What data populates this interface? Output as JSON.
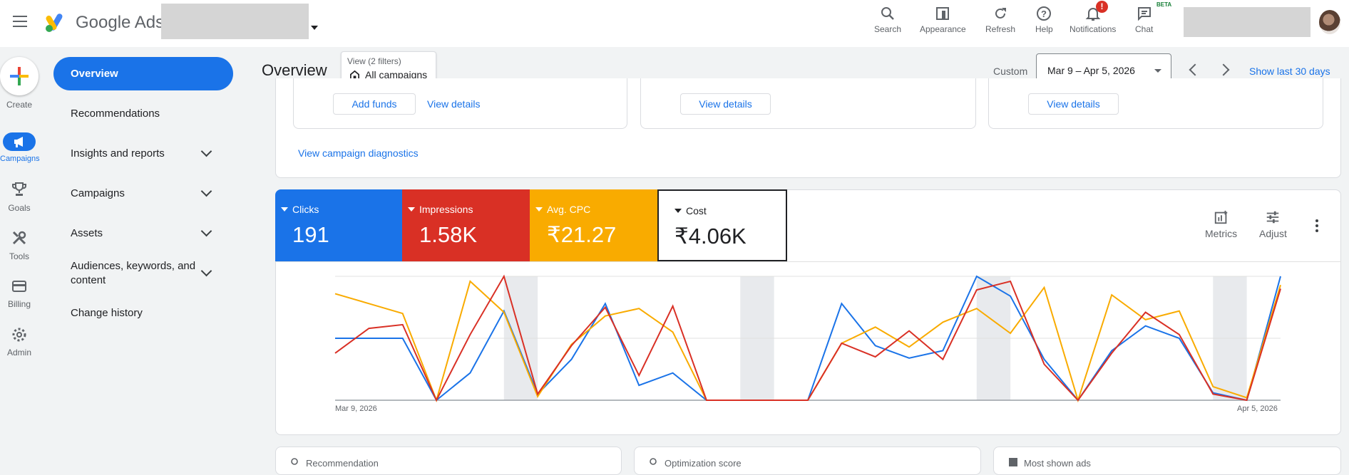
{
  "header": {
    "brand": "Google Ads",
    "tools": [
      {
        "label": "Search",
        "icon": "search-icon"
      },
      {
        "label": "Appearance",
        "icon": "appearance-icon"
      },
      {
        "label": "Refresh",
        "icon": "refresh-icon"
      },
      {
        "label": "Help",
        "icon": "help-icon"
      },
      {
        "label": "Notifications",
        "icon": "bell-icon"
      },
      {
        "label": "Chat",
        "icon": "chat-icon"
      }
    ],
    "notification_badge": "!",
    "chat_badge": "BETA"
  },
  "rail": [
    {
      "label": "Create",
      "icon": "plus-icon"
    },
    {
      "label": "Campaigns",
      "icon": "megaphone-icon"
    },
    {
      "label": "Goals",
      "icon": "trophy-icon"
    },
    {
      "label": "Tools",
      "icon": "wrench-icon"
    },
    {
      "label": "Billing",
      "icon": "card-icon"
    },
    {
      "label": "Admin",
      "icon": "gear-icon"
    }
  ],
  "sidenav": [
    {
      "label": "Overview",
      "active": true
    },
    {
      "label": "Recommendations"
    },
    {
      "label": "Insights and reports",
      "expandable": true
    },
    {
      "label": "Campaigns",
      "expandable": true
    },
    {
      "label": "Assets",
      "expandable": true
    },
    {
      "label": "Audiences, keywords, and content",
      "expandable": true
    },
    {
      "label": "Change history"
    }
  ],
  "page": {
    "title": "Overview",
    "filter_small": "View (2 filters)",
    "filter_main": "All campaigns",
    "date_label": "Custom",
    "date_range": "Mar 9 – Apr 5, 2026",
    "show_last": "Show last 30 days"
  },
  "top_cards": {
    "add_funds": "Add funds",
    "view_details": "View details",
    "diagnostics": "View campaign diagnostics"
  },
  "metrics": [
    {
      "label": "Clicks",
      "value": "191",
      "color": "#1a73e8"
    },
    {
      "label": "Impressions",
      "value": "1.58K",
      "color": "#d93025"
    },
    {
      "label": "Avg. CPC",
      "value": "₹21.27",
      "color": "#f9ab00"
    },
    {
      "label": "Cost",
      "value": "₹4.06K",
      "color": "#ffffff"
    }
  ],
  "chart_tools": {
    "metrics": "Metrics",
    "adjust": "Adjust"
  },
  "chart_data": {
    "type": "line",
    "x_start": "Mar 9, 2026",
    "x_end": "Apr 5, 2026",
    "weekend_shading": [
      [
        5,
        6
      ],
      [
        12,
        13
      ],
      [
        19,
        20
      ],
      [
        26,
        27
      ]
    ],
    "ylim": [
      0,
      1
    ],
    "series": [
      {
        "color": "#1a73e8",
        "values": [
          0.5,
          0.5,
          0.5,
          0.0,
          0.22,
          0.72,
          0.05,
          0.33,
          0.78,
          0.12,
          0.22,
          0.0,
          0.0,
          0.0,
          0.0,
          0.78,
          0.44,
          0.34,
          0.4,
          1.0,
          0.84,
          0.33,
          0.0,
          0.4,
          0.6,
          0.5,
          0.06,
          0.0,
          1.0
        ]
      },
      {
        "color": "#d93025",
        "values": [
          0.38,
          0.58,
          0.61,
          0.0,
          0.53,
          1.0,
          0.05,
          0.44,
          0.75,
          0.2,
          0.76,
          0.0,
          0.0,
          0.0,
          0.0,
          0.46,
          0.35,
          0.56,
          0.33,
          0.89,
          0.96,
          0.29,
          0.0,
          0.38,
          0.71,
          0.53,
          0.05,
          0.0,
          0.9
        ]
      },
      {
        "color": "#f9ab00",
        "values": [
          0.86,
          0.78,
          0.7,
          0.0,
          0.96,
          0.71,
          0.03,
          0.45,
          0.68,
          0.74,
          0.55,
          0.0,
          0.0,
          0.0,
          0.0,
          0.46,
          0.59,
          0.43,
          0.63,
          0.74,
          0.54,
          0.91,
          0.0,
          0.85,
          0.65,
          0.72,
          0.11,
          0.02,
          0.93
        ]
      }
    ]
  },
  "bottom_cards": [
    "Recommendation",
    "Optimization score",
    "Most shown ads"
  ]
}
